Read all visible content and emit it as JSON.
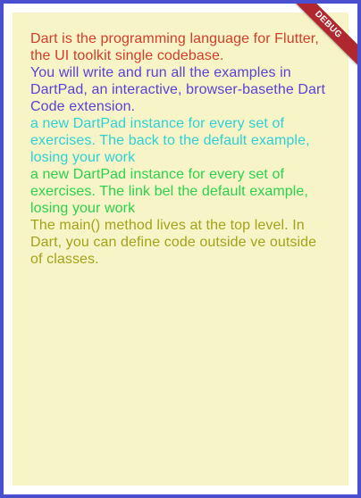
{
  "colors": {
    "frame_border": "#4a4fd0",
    "panel_background": "#f7f5c8",
    "debug_ribbon": "#b0272f"
  },
  "debug_banner": {
    "label": "DEBUG"
  },
  "paragraphs": [
    {
      "text": "Dart is the programming language for Flutter, the UI toolkit  single codebase.",
      "color": "#d23c2a"
    },
    {
      "text": "You will write and run all the examples in DartPad, an interactive, browser-basethe Dart Code extension.",
      "color": "#5a42d4"
    },
    {
      "text": "a new DartPad instance for every set of exercises. The back to the default example, losing your work",
      "color": "#2ed0d6"
    },
    {
      "text": "a new DartPad instance for every set of exercises. The link bel the default example, losing your work",
      "color": "#2bd14e"
    },
    {
      "text": "The main() method lives at the top level. In Dart, you can define code outside ve outside of classes.",
      "color": "#a3a219"
    }
  ]
}
